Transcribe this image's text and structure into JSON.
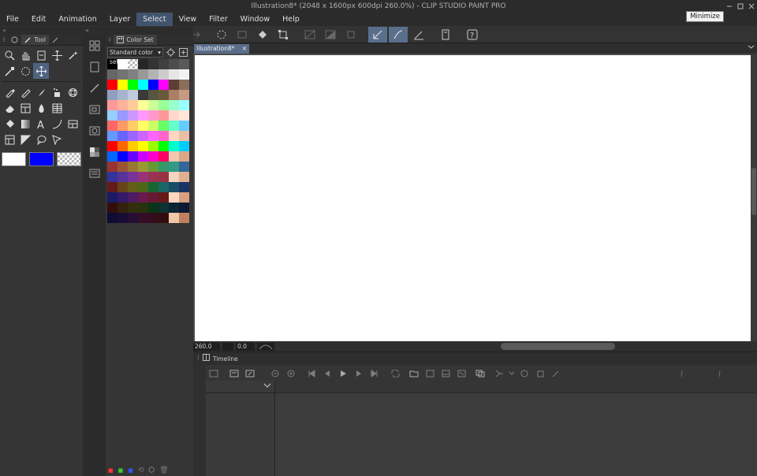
{
  "window": {
    "title": "Illustration8* (2048 x 1600px 600dpi 260.0%) - CLIP STUDIO PAINT PRO",
    "tooltip": "Minimize"
  },
  "menu": {
    "items": [
      "File",
      "Edit",
      "Animation",
      "Layer",
      "Select",
      "View",
      "Filter",
      "Window",
      "Help"
    ],
    "active": "Select"
  },
  "tool_panel": {
    "tab_label": "Tool",
    "main_color": "#ffffff",
    "sub_color": "#0000ff"
  },
  "color_set": {
    "tab_label": "Color Set",
    "selected_set": "Standard color set",
    "swatches": [
      [
        "#000000",
        "#ffffff",
        "checker",
        "#262626",
        "#333333",
        "#404040",
        "#4d4d4d",
        "#595959"
      ],
      [
        "#666666",
        "#737373",
        "#808080",
        "#999999",
        "#b3b3b3",
        "#cccccc",
        "#e6e6e6",
        "#f2f2f2"
      ],
      [
        "#ff0000",
        "#ffff00",
        "#00ff00",
        "#00ffff",
        "#0000ff",
        "#ff00ff",
        "#5c4033",
        "#8b6d5c"
      ],
      [
        "#8fa0c0",
        "#a8b4cc",
        "#c0ccdc",
        "#3a3a3a",
        "#555540",
        "#6b5a3a",
        "#a88066",
        "#c49a80"
      ],
      [
        "#ff9999",
        "#ffb399",
        "#ffcc99",
        "#ffff99",
        "#ccff99",
        "#99ff99",
        "#99ffcc",
        "#99ffff"
      ],
      [
        "#99ccff",
        "#9999ff",
        "#cc99ff",
        "#ff99ff",
        "#ff99cc",
        "#ff9999",
        "#ffd9cc",
        "#ffe6d9"
      ],
      [
        "#ff6666",
        "#ff9966",
        "#ffcc66",
        "#ffff66",
        "#ccff66",
        "#66ff66",
        "#66ffcc",
        "#66ccff"
      ],
      [
        "#6699ff",
        "#6666ff",
        "#9966ff",
        "#cc66ff",
        "#ff66ff",
        "#ff66cc",
        "#ffd6c2",
        "#e8c0a8"
      ],
      [
        "#ff0000",
        "#ff6600",
        "#ffcc00",
        "#ffff00",
        "#99ff00",
        "#00ff00",
        "#00ffcc",
        "#00ccff"
      ],
      [
        "#0066ff",
        "#0000ff",
        "#6600ff",
        "#cc00ff",
        "#ff00cc",
        "#ff0066",
        "#f0c8b0",
        "#d9a888"
      ],
      [
        "#993333",
        "#995533",
        "#997733",
        "#999933",
        "#669933",
        "#339966",
        "#339988",
        "#336699"
      ],
      [
        "#333399",
        "#553399",
        "#773399",
        "#993377",
        "#993355",
        "#993344",
        "#f5d5c0",
        "#e0b090"
      ],
      [
        "#661a1a",
        "#664419",
        "#665c19",
        "#4d661a",
        "#1a6633",
        "#1a6666",
        "#1a4d66",
        "#1a3366"
      ],
      [
        "#1a1a66",
        "#331a66",
        "#4d1a66",
        "#661a4d",
        "#661a33",
        "#661a1a",
        "#f8d8c0",
        "#d9a080"
      ],
      [
        "#330d0d",
        "#33200d",
        "#332e0d",
        "#26330d",
        "#0d3318",
        "#0d3333",
        "#0d2633",
        "#0d1a33"
      ],
      [
        "#0d0d33",
        "#1a0d33",
        "#260d33",
        "#330d26",
        "#330d1a",
        "#330d0d",
        "#f0c8a8",
        "#c08060"
      ]
    ]
  },
  "document": {
    "tab_label": "Illustration8*",
    "close": "×"
  },
  "status": {
    "zoom": "260.0",
    "angle": "0.0"
  },
  "timeline": {
    "tab_label": "Timeline"
  },
  "icons": {
    "hamburger": "☰",
    "chevron_down": "⌄",
    "chevron_left": "«",
    "chevron_up": "⌃"
  }
}
